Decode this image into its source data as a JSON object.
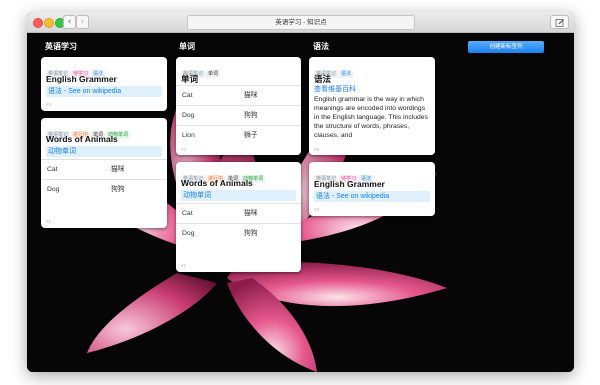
{
  "window": {
    "title": "英语学习 - 知识点",
    "nav_back": "‹",
    "nav_forward": "›",
    "edit_icon": "pencil-square-icon"
  },
  "toolbar": {
    "create_button_label": "创建新标签列",
    "accent_color": "#1b80ee"
  },
  "columns": [
    {
      "title": "英语学习",
      "cards": [
        {
          "tags": [
            "英语笔记",
            "待学习",
            "语法"
          ],
          "title": "English Grammer",
          "subtitle": "语法 - See on wikipedia",
          "id": "#3"
        },
        {
          "tags": [
            "英语笔记",
            "进行中",
            "单词",
            "动物单词"
          ],
          "title": "Words of Animals",
          "subtitle": "动物单词",
          "rows": [
            [
              "Cat",
              "猫咪"
            ],
            [
              "Dog",
              "狗狗"
            ]
          ],
          "id": "#1"
        }
      ]
    },
    {
      "title": "单词",
      "cards": [
        {
          "tags": [
            "英语笔记",
            "单词"
          ],
          "title": "单词",
          "rows": [
            [
              "Cat",
              "猫咪"
            ],
            [
              "Dog",
              "狗狗"
            ],
            [
              "Lion",
              "狮子"
            ]
          ],
          "id": "#4"
        },
        {
          "tags": [
            "英语笔记",
            "进行中",
            "单词",
            "动物单词"
          ],
          "title": "Words of Animals",
          "subtitle": "动物单词",
          "rows": [
            [
              "Cat",
              "猫咪"
            ],
            [
              "Dog",
              "狗狗"
            ]
          ],
          "id": "#1"
        }
      ]
    },
    {
      "title": "语法",
      "cards": [
        {
          "tags": [
            "英语笔记",
            "语法"
          ],
          "title": "语法",
          "link": "查看维基百科",
          "text": "English grammar is the way in which meanings are encoded into wordings in the English language. This includes the structure of words, phrases, clauses, and",
          "id": "#5"
        },
        {
          "tags": [
            "英语笔记",
            "待学习",
            "语法"
          ],
          "title": "English Grammer",
          "subtitle": "语法 - See on wikipedia",
          "id": "#3"
        }
      ]
    }
  ]
}
